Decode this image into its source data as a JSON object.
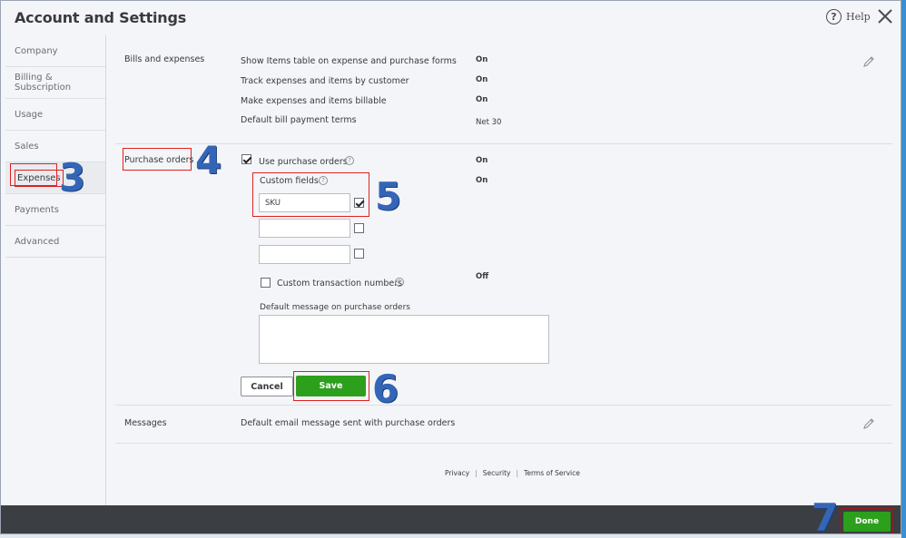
{
  "header": {
    "title": "Account and Settings",
    "help_label": "Help"
  },
  "sidebar": {
    "items": [
      {
        "label": "Company"
      },
      {
        "label": "Billing & Subscription"
      },
      {
        "label": "Usage"
      },
      {
        "label": "Sales"
      },
      {
        "label": "Expenses"
      },
      {
        "label": "Payments"
      },
      {
        "label": "Advanced"
      }
    ],
    "active": "Expenses"
  },
  "bills": {
    "title": "Bills and expenses",
    "rows": [
      {
        "label": "Show Items table on expense and purchase forms",
        "value": "On"
      },
      {
        "label": "Track expenses and items by customer",
        "value": "On"
      },
      {
        "label": "Make expenses and items billable",
        "value": "On"
      },
      {
        "label": "Default bill payment terms",
        "value": "Net 30"
      }
    ]
  },
  "purchase_orders": {
    "title": "Purchase orders",
    "use_po_label": "Use purchase orders",
    "use_po_checked": true,
    "use_po_value": "On",
    "custom_fields_label": "Custom fields",
    "custom_fields_value": "On",
    "fields": [
      {
        "value": "SKU",
        "checked": true
      },
      {
        "value": "",
        "checked": false
      },
      {
        "value": "",
        "checked": false
      }
    ],
    "custom_txn_label": "Custom transaction numbers",
    "custom_txn_checked": false,
    "custom_txn_value": "Off",
    "default_message_label": "Default message on purchase orders",
    "default_message_value": "",
    "cancel_label": "Cancel",
    "save_label": "Save"
  },
  "messages": {
    "title": "Messages",
    "row_label": "Default email message sent with purchase orders"
  },
  "footer": {
    "links": [
      "Privacy",
      "Security",
      "Terms of Service"
    ],
    "done_label": "Done"
  },
  "steps": [
    "3",
    "4",
    "5",
    "6",
    "7"
  ],
  "colors": {
    "accent_green": "#2ca01c",
    "annotation_red": "#e02020",
    "annotation_blue": "#3466b8",
    "footer_bar": "#3b3e42"
  }
}
